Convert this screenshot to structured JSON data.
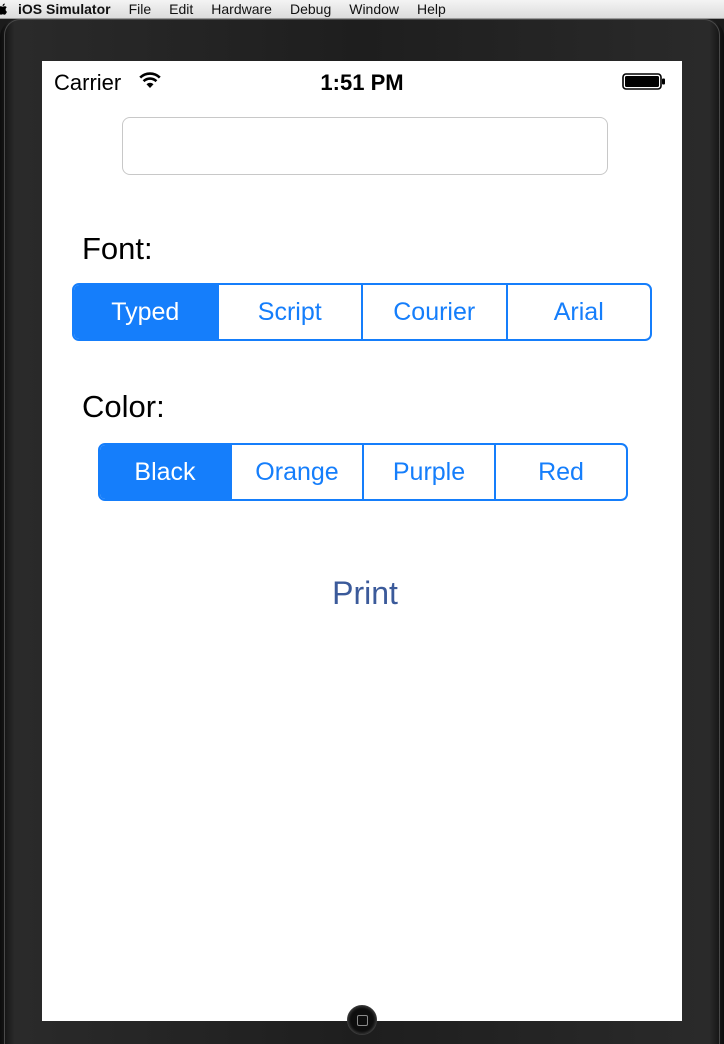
{
  "menubar": {
    "app_name": "iOS Simulator",
    "items": [
      "File",
      "Edit",
      "Hardware",
      "Debug",
      "Window",
      "Help"
    ]
  },
  "status_bar": {
    "carrier": "Carrier",
    "time": "1:51 PM"
  },
  "text_field": {
    "value": "",
    "placeholder": ""
  },
  "font_section": {
    "label": "Font:",
    "options": [
      "Typed",
      "Script",
      "Courier",
      "Arial"
    ],
    "selected": "Typed"
  },
  "color_section": {
    "label": "Color:",
    "options": [
      "Black",
      "Orange",
      "Purple",
      "Red"
    ],
    "selected": "Black"
  },
  "print_button": {
    "label": "Print"
  },
  "colors": {
    "accent": "#157efb",
    "print_text": "#3b5a9a"
  }
}
